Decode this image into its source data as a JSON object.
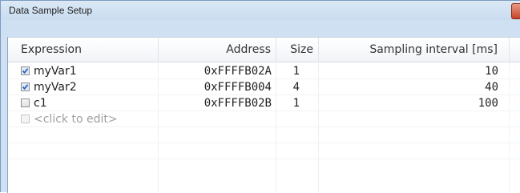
{
  "window": {
    "title": "Data Sample Setup"
  },
  "columns": {
    "expression": "Expression",
    "address": "Address",
    "size": "Size",
    "sampling_interval": "Sampling interval [ms]"
  },
  "rows": [
    {
      "checked": true,
      "expression": "myVar1",
      "address": "0xFFFFB02A",
      "size": "1",
      "sampling_interval": "10"
    },
    {
      "checked": true,
      "expression": "myVar2",
      "address": "0xFFFFB004",
      "size": "4",
      "sampling_interval": "40"
    },
    {
      "checked": false,
      "expression": "c1",
      "address": "0xFFFFB02B",
      "size": "1",
      "sampling_interval": "100"
    }
  ],
  "new_row": {
    "placeholder": "<click to edit>"
  },
  "colors": {
    "titlebar": "#cfe0f2",
    "close_button": "#c7432a",
    "checkbox_check": "#2b5fb3",
    "placeholder_text": "#a0a0a0"
  },
  "icons": {
    "close": "close-icon",
    "checkbox": "checkbox-icon"
  }
}
